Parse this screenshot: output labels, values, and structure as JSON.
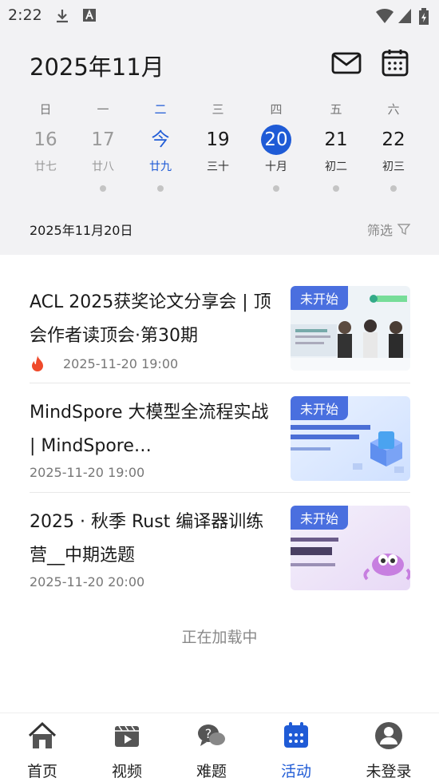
{
  "status_bar": {
    "time": "2:22"
  },
  "header": {
    "month_title": "2025年11月"
  },
  "week": [
    {
      "dow": "日",
      "day": "16",
      "lunar": "廿七",
      "state": "past",
      "dot": false
    },
    {
      "dow": "一",
      "day": "17",
      "lunar": "廿八",
      "state": "past",
      "dot": true
    },
    {
      "dow": "二",
      "day": "今",
      "lunar": "廿九",
      "state": "today",
      "dot": true
    },
    {
      "dow": "三",
      "day": "19",
      "lunar": "三十",
      "state": "normal",
      "dot": false
    },
    {
      "dow": "四",
      "day": "20",
      "lunar": "十月",
      "state": "selected",
      "dot": true
    },
    {
      "dow": "五",
      "day": "21",
      "lunar": "初二",
      "state": "normal",
      "dot": true
    },
    {
      "dow": "六",
      "day": "22",
      "lunar": "初三",
      "state": "normal",
      "dot": true
    }
  ],
  "selected_date": "2025年11月20日",
  "filter_label": "筛选",
  "events": [
    {
      "title": "ACL 2025获奖论文分享会 | 顶会作者读顶会·第30期",
      "time": "2025-11-20 19:00",
      "hot": true,
      "badge": "未开始"
    },
    {
      "title": "MindSpore 大模型全流程实战 | MindSpore…",
      "time": "2025-11-20 19:00",
      "hot": false,
      "badge": "未开始"
    },
    {
      "title": "2025 · 秋季 Rust 编译器训练营__中期选题",
      "time": "2025-11-20 20:00",
      "hot": false,
      "badge": "未开始"
    }
  ],
  "loading_text": "正在加载中",
  "tabs": [
    {
      "label": "首页",
      "icon": "home-icon"
    },
    {
      "label": "视频",
      "icon": "video-icon"
    },
    {
      "label": "难题",
      "icon": "question-icon"
    },
    {
      "label": "活动",
      "icon": "calendar-icon",
      "active": true
    },
    {
      "label": "未登录",
      "icon": "user-icon"
    }
  ],
  "colors": {
    "accent": "#1f5bd6",
    "badge": "#3c64dc",
    "hot": "#ef4a2b"
  }
}
